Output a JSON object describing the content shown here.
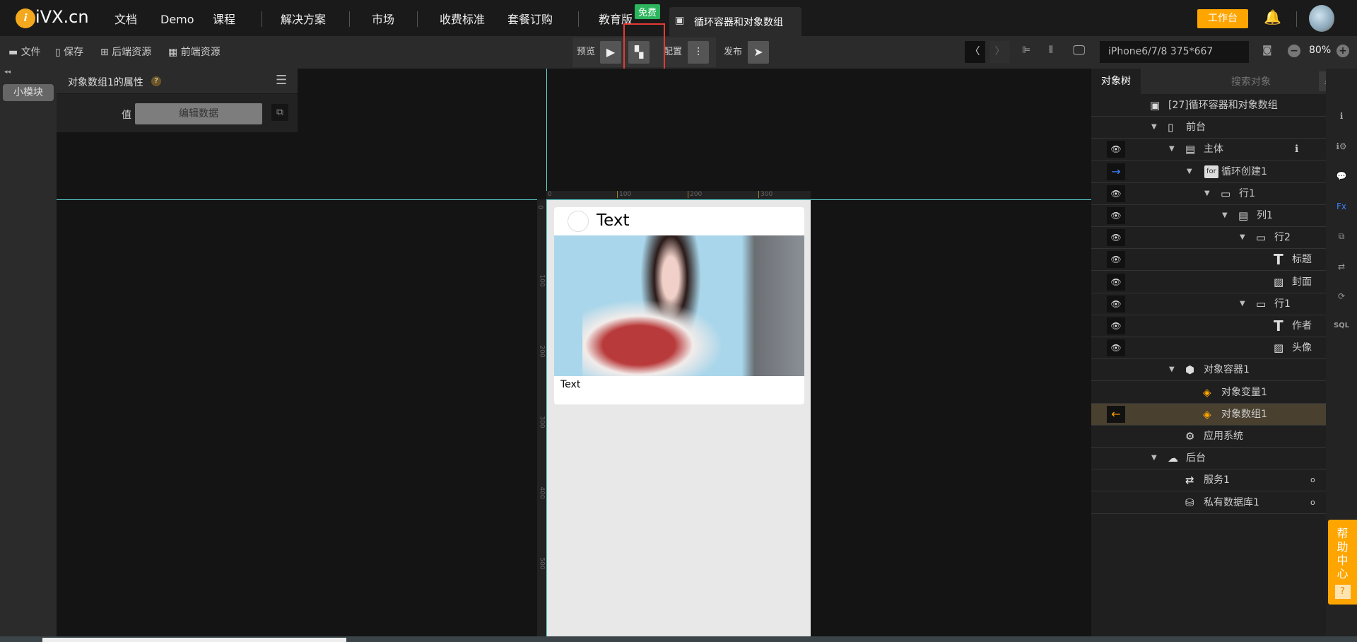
{
  "topbar": {
    "logo": "iVX.cn",
    "nav": [
      "文档",
      "Demo",
      "课程",
      "解决方案",
      "市场",
      "收费标准",
      "套餐订购",
      "教育版"
    ],
    "free_badge": "免费",
    "project_tab": "循环容器和对象数组",
    "workspace_button": "工作台"
  },
  "toolbar": {
    "file": "文件",
    "save": "保存",
    "backend_res": "后端资源",
    "frontend_res": "前端资源",
    "preview": "预览",
    "config": "配置",
    "publish": "发布",
    "device": "iPhone6/7/8 375*667",
    "zoom": "80%"
  },
  "left": {
    "collapse": "◂◂",
    "module_button": "小模块"
  },
  "props": {
    "title": "对象数组1的属性",
    "help": "?",
    "value_label": "值",
    "edit_button": "编辑数据"
  },
  "canvas": {
    "ruler_x": [
      "0",
      "100",
      "200",
      "300"
    ],
    "ruler_y": [
      "0",
      "100",
      "200",
      "300",
      "400",
      "500"
    ],
    "card_title": "Text",
    "card_author": "Text"
  },
  "right": {
    "tab": "对象树",
    "search_placeholder": "搜索对象",
    "tree": [
      {
        "label": "[27]循环容器和对象数组",
        "depth": 0,
        "icon": "page-icon",
        "eye": false,
        "arrow": false
      },
      {
        "label": "前台",
        "depth": 1,
        "icon": "phone-icon",
        "eye": false,
        "arrow": true
      },
      {
        "label": "主体",
        "depth": 2,
        "icon": "column-icon",
        "eye": true,
        "arrow": true
      },
      {
        "label": "循环创建1",
        "depth": 3,
        "icon": "for-icon",
        "eye": false,
        "arrow": true,
        "link": "→"
      },
      {
        "label": "行1",
        "depth": 4,
        "icon": "row-icon",
        "eye": true,
        "arrow": true
      },
      {
        "label": "列1",
        "depth": 5,
        "icon": "column-icon",
        "eye": true,
        "arrow": true
      },
      {
        "label": "行2",
        "depth": 6,
        "icon": "row-icon",
        "eye": true,
        "arrow": true
      },
      {
        "label": "标题",
        "depth": 7,
        "icon": "text-icon",
        "eye": true,
        "arrow": false
      },
      {
        "label": "封面",
        "depth": 7,
        "icon": "image-icon",
        "eye": true,
        "arrow": false
      },
      {
        "label": "行1",
        "depth": 6,
        "icon": "row-icon",
        "eye": true,
        "arrow": true
      },
      {
        "label": "作者",
        "depth": 7,
        "icon": "text-icon",
        "eye": true,
        "arrow": false
      },
      {
        "label": "头像",
        "depth": 7,
        "icon": "image-icon",
        "eye": true,
        "arrow": false
      },
      {
        "label": "对象容器1",
        "depth": 2,
        "icon": "box-icon",
        "eye": false,
        "arrow": true
      },
      {
        "label": "对象变量1",
        "depth": 3,
        "icon": "object-var-icon",
        "eye": false,
        "arrow": false
      },
      {
        "label": "对象数组1",
        "depth": 3,
        "icon": "object-array-icon",
        "eye": false,
        "arrow": false,
        "link": "←",
        "selected": true
      },
      {
        "label": "应用系统",
        "depth": 2,
        "icon": "gear-icon",
        "eye": false,
        "arrow": false
      },
      {
        "label": "后台",
        "depth": 1,
        "icon": "cloud-server-icon",
        "eye": false,
        "arrow": true
      },
      {
        "label": "服务1",
        "depth": 2,
        "icon": "service-icon",
        "eye": false,
        "arrow": false,
        "dot": "o"
      },
      {
        "label": "私有数据库1",
        "depth": 2,
        "icon": "database-icon",
        "eye": false,
        "arrow": false,
        "dot": "o"
      }
    ]
  },
  "help_center": "帮助中心",
  "colors": {
    "accent": "#ffa500",
    "selected_row": "#4a4030",
    "guide": "#5fd6d6",
    "highlight_box": "#e53935",
    "free_badge": "#2db55d",
    "link_blue": "#3d7fff"
  }
}
